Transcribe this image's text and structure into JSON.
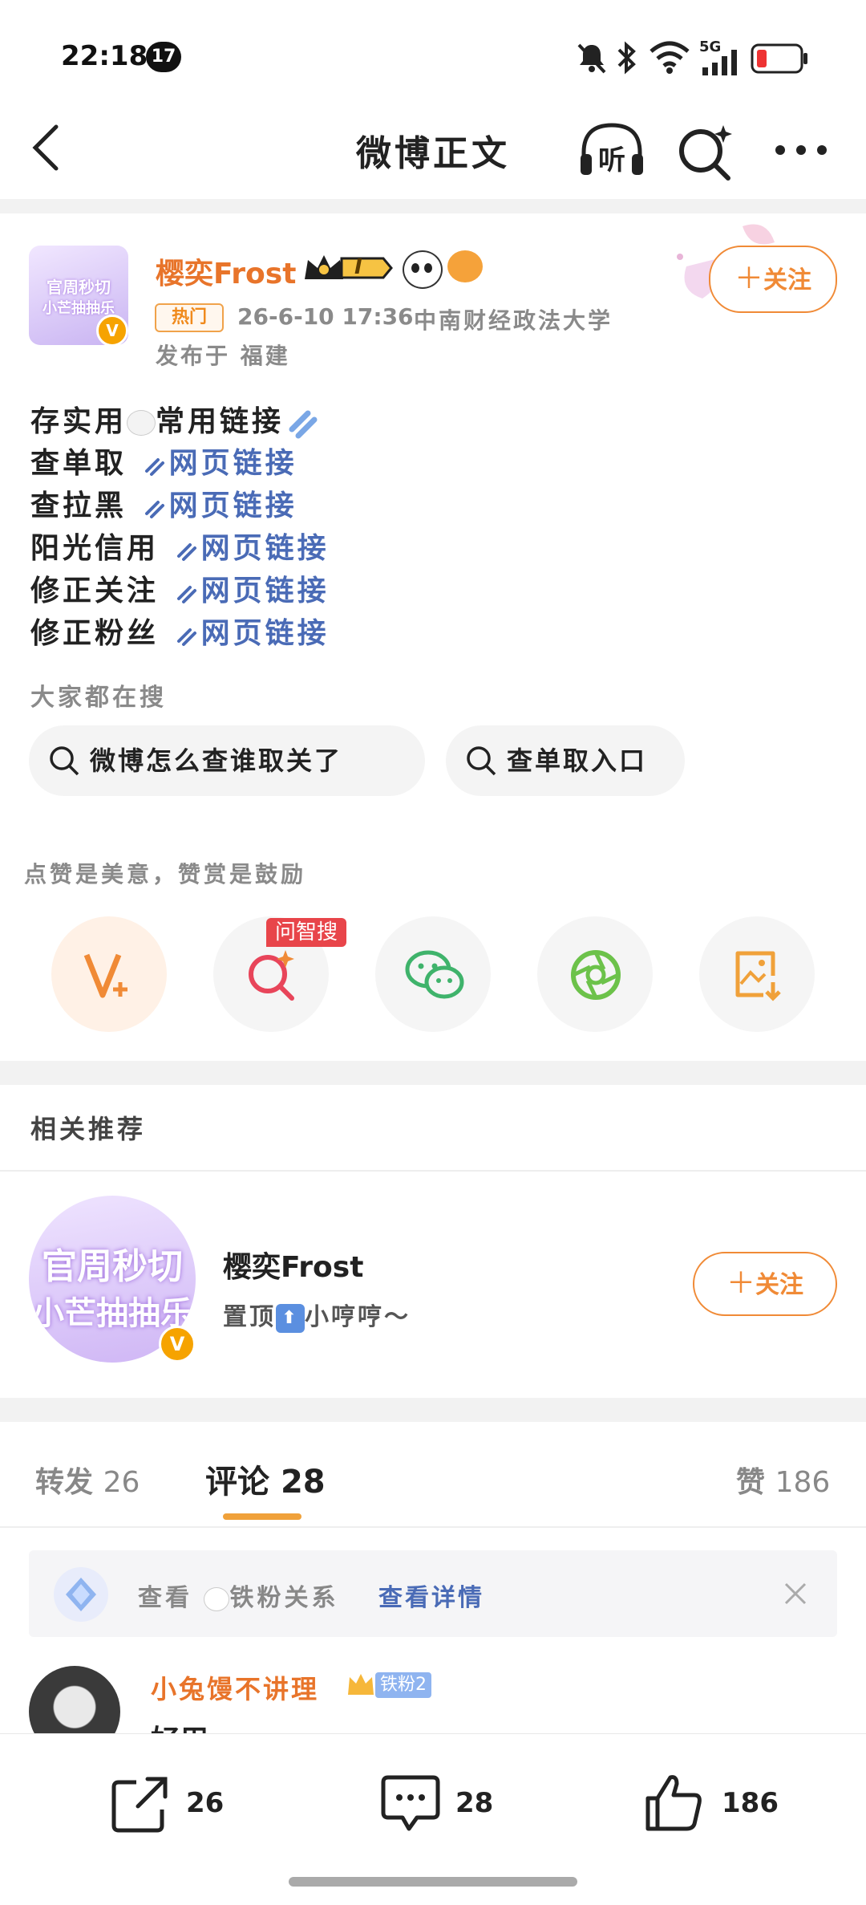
{
  "status_bar": {
    "time": "22:18",
    "notification_count": "17",
    "network": "5G"
  },
  "nav": {
    "title": "微博正文",
    "listen_label": "听"
  },
  "author": {
    "name": "樱奕Frost",
    "level_badge": "I",
    "hot_tag": "热门",
    "datetime": "26-6-10 17:36",
    "school": "中南财经政法大学",
    "location": "发布于 福建",
    "follow_label": "关注"
  },
  "post": {
    "title_line": "存实用",
    "title_line_b": "常用链接",
    "lines": [
      {
        "label": "查单取",
        "link": "网页链接"
      },
      {
        "label": "查拉黑",
        "link": "网页链接"
      },
      {
        "label": "阳光信用",
        "link": "网页链接"
      },
      {
        "label": "修正关注",
        "link": "网页链接"
      },
      {
        "label": "修正粉丝",
        "link": "网页链接"
      }
    ]
  },
  "search_section": {
    "header": "大家都在搜",
    "chips": [
      "微博怎么查谁取关了",
      "查单取入口"
    ]
  },
  "reward": {
    "prompt": "点赞是美意，赞赏是鼓励",
    "ai_badge": "问智搜"
  },
  "recommend": {
    "header": "相关推荐",
    "name": "樱奕Frost",
    "desc_a": "置顶",
    "desc_b": "小哼哼～",
    "follow_label": "关注",
    "avatar_text_1": "官周秒切",
    "avatar_text_2": "小芒抽抽乐"
  },
  "tabs": {
    "repost_label": "转发",
    "repost_count": "26",
    "comment_label": "评论",
    "comment_count": "28",
    "like_label": "赞",
    "like_count": "186"
  },
  "fan_banner": {
    "text_a": "查看",
    "text_b": "铁粉关系",
    "link": "查看详情"
  },
  "comment": {
    "user": "小兔馒不讲理",
    "fan_badge": "铁粉2",
    "text": "好用"
  },
  "bottom_bar": {
    "repost": "26",
    "comment": "28",
    "like": "186"
  },
  "colors": {
    "accent": "#f08a36",
    "link": "#4a6bb6",
    "brand_orange": "#e8742a"
  }
}
